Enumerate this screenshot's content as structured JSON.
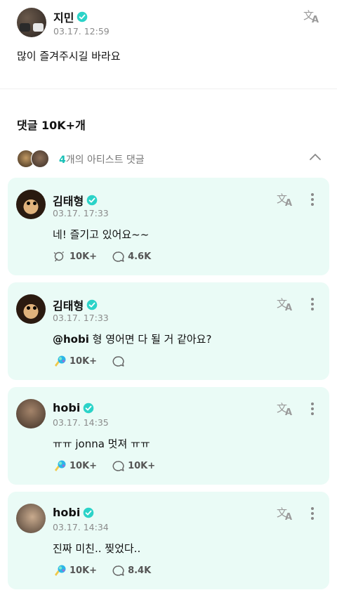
{
  "post": {
    "author": "지민",
    "timestamp": "03.17. 12:59",
    "body": "많이 즐겨주시길 바라요"
  },
  "comments_count": "댓글 10K+개",
  "artist_comments": {
    "count": "4",
    "label": "개의 아티스트 댓글"
  },
  "comments": [
    {
      "author": "김태형",
      "timestamp": "03.17. 17:33",
      "mention": "",
      "text": "네! 즐기고 있어요~~",
      "likes": "10K+",
      "replies": "4.6K",
      "like_icon": "outline-like-icon"
    },
    {
      "author": "김태형",
      "timestamp": "03.17. 17:33",
      "mention": "@hobi",
      "text": " 형 영어면 다 될 거 같아요?",
      "likes": "10K+",
      "replies": "",
      "like_icon": "colored-like-icon"
    },
    {
      "author": "hobi",
      "timestamp": "03.17. 14:35",
      "mention": "",
      "text": "ㅠㅠ jonna 멋져 ㅠㅠ",
      "likes": "10K+",
      "replies": "10K+",
      "like_icon": "colored-like-icon"
    },
    {
      "author": "hobi",
      "timestamp": "03.17. 14:34",
      "mention": "",
      "text": "진짜 미친.. 찢었다..",
      "likes": "10K+",
      "replies": "8.4K",
      "like_icon": "colored-like-icon"
    }
  ],
  "colors": {
    "accent": "#17c0b6",
    "card_bg": "#eafbf6"
  }
}
